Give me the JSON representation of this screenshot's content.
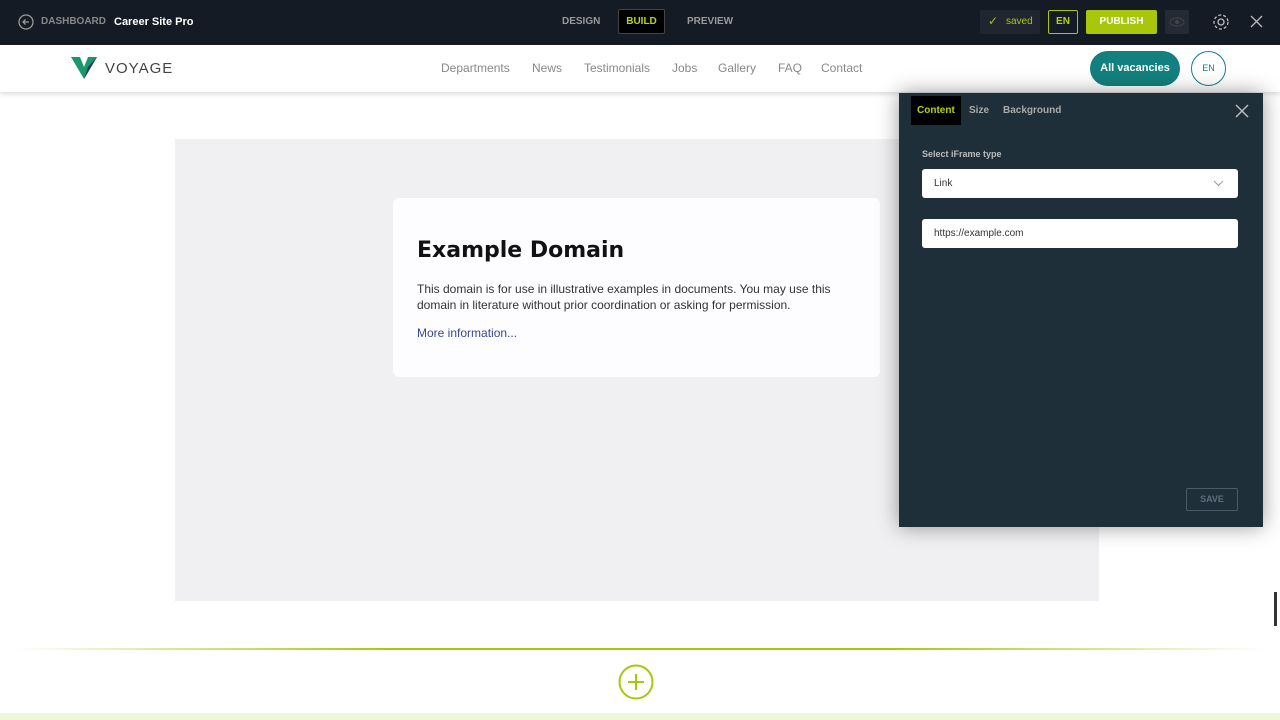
{
  "topbar": {
    "dashboard": "DASHBOARD",
    "site_name": "Career Site Pro",
    "modes": [
      "DESIGN",
      "BUILD",
      "PREVIEW"
    ],
    "saved": "saved",
    "lang": "EN",
    "publish": "PUBLISH"
  },
  "site": {
    "logo": "VOYAGE",
    "nav": [
      "Departments",
      "News",
      "Testimonials",
      "Jobs",
      "Gallery",
      "FAQ",
      "Contact"
    ],
    "cta": "All vacancies",
    "lang": "EN"
  },
  "iframe": {
    "title": "Example Domain",
    "body": "This domain is for use in illustrative examples in documents. You may use this domain in literature without prior coordination or asking for permission.",
    "link": "More information..."
  },
  "panel": {
    "tabs": [
      "Content",
      "Size",
      "Background"
    ],
    "type_label": "Select iFrame type",
    "type_value": "Link",
    "url_value": "https://example.com",
    "save": "SAVE"
  },
  "colors": {
    "accent": "#a8c70a",
    "teal": "#12807e"
  }
}
